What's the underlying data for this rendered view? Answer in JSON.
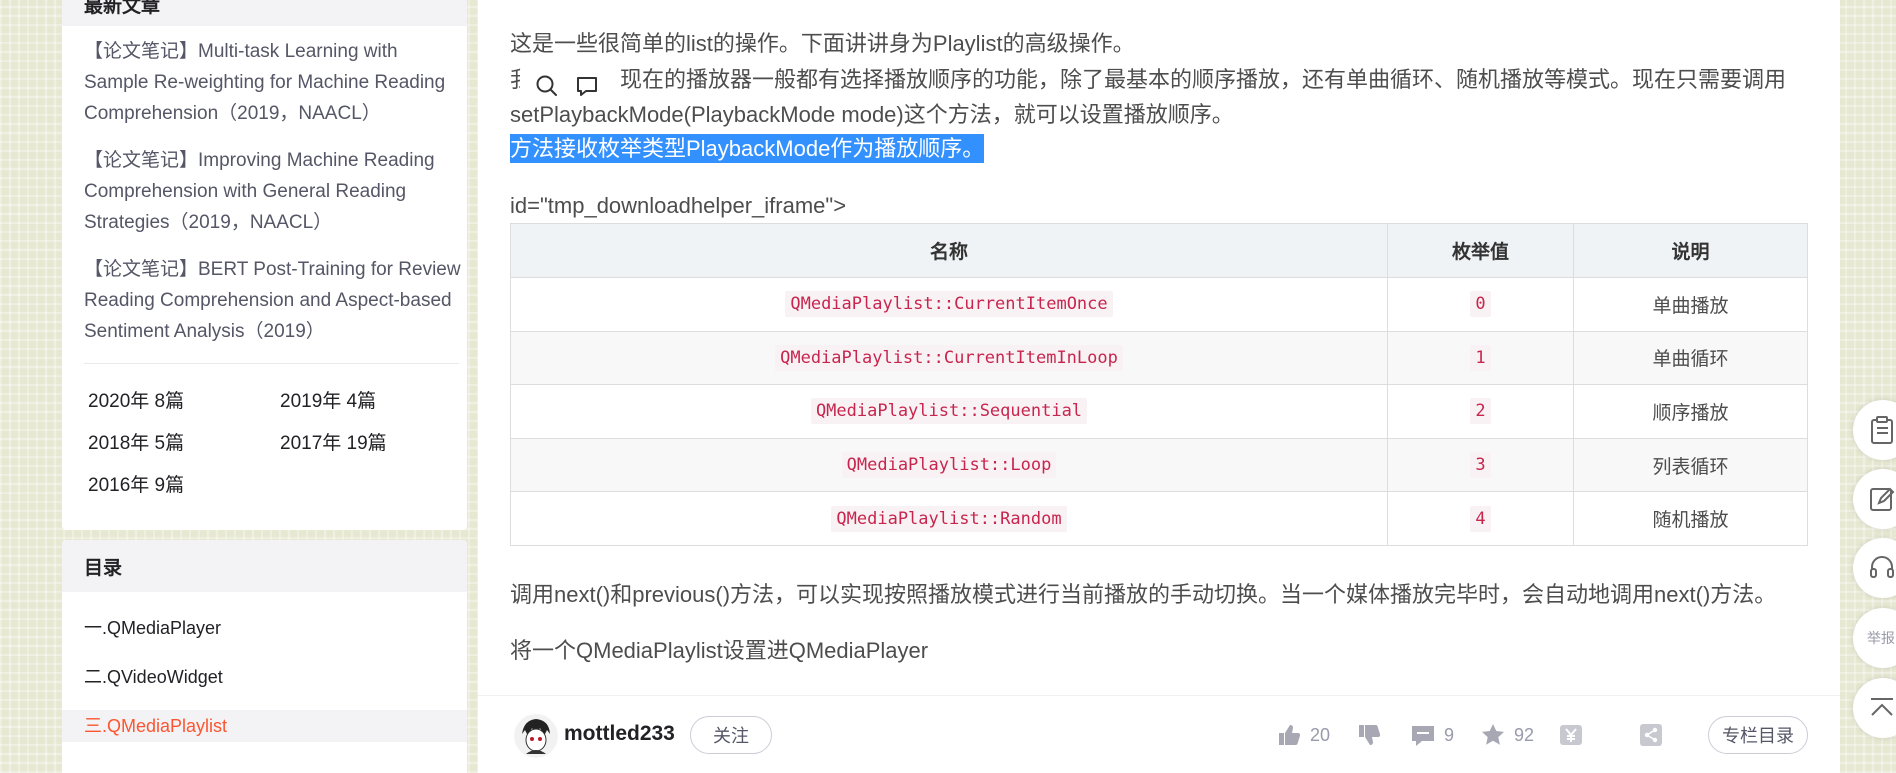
{
  "sidebar": {
    "recent_title": "最新文章",
    "articles": [
      "【论文笔记】Multi-task Learning with Sample Re-weighting for Machine Reading Comprehension（2019，NAACL）",
      "【论文笔记】Improving Machine Reading Comprehension with General Reading Strategies（2019，NAACL）",
      "【论文笔记】BERT Post-Training for Review Reading Comprehension and Aspect-based Sentiment Analysis（2019）"
    ],
    "archives": [
      "2020年  8篇",
      "2019年  4篇",
      "2018年  5篇",
      "2017年  19篇",
      "2016年  9篇"
    ],
    "toc_title": "目录",
    "toc": [
      "一.QMediaPlayer",
      "二.QVideoWidget",
      "三.QMediaPlaylist"
    ],
    "toc_active_index": 2
  },
  "article": {
    "p1": "这是一些很简单的list的操作。下面讲讲身为Playlist的高级操作。",
    "p2a": "我们知道，现在的播放器一般都有选择播放顺序的功能，除了最基本的顺序播放，还有单曲循环、随机播放等模式。现在只需要调用",
    "p2b": "setPlaybackMode(PlaybackMode mode)这个方法，就可以设置播放顺序。",
    "p3_selected": "方法接收枚举类型PlaybackMode作为播放顺序。",
    "p4": "id=\"tmp_downloadhelper_iframe\">",
    "table": {
      "headers": [
        "名称",
        "枚举值",
        "说明"
      ],
      "rows": [
        [
          "QMediaPlaylist::CurrentItemOnce",
          "0",
          "单曲播放"
        ],
        [
          "QMediaPlaylist::CurrentItemInLoop",
          "1",
          "单曲循环"
        ],
        [
          "QMediaPlaylist::Sequential",
          "2",
          "顺序播放"
        ],
        [
          "QMediaPlaylist::Loop",
          "3",
          "列表循环"
        ],
        [
          "QMediaPlaylist::Random",
          "4",
          "随机播放"
        ]
      ]
    },
    "p5": "调用next()和previous()方法，可以实现按照播放模式进行当前播放的手动切换。当一个媒体播放完毕时，会自动地调用next()方法。",
    "p6": "将一个QMediaPlaylist设置进QMediaPlayer"
  },
  "toolbar": {
    "author": "mottled233",
    "follow": "关注",
    "likes": "20",
    "comments": "9",
    "favorites": "92",
    "column": "专栏目录"
  },
  "side_tools": {
    "report": "举报"
  },
  "colors": {
    "accent": "#fc5531",
    "selection": "#3390ff",
    "code": "#c7254e"
  }
}
